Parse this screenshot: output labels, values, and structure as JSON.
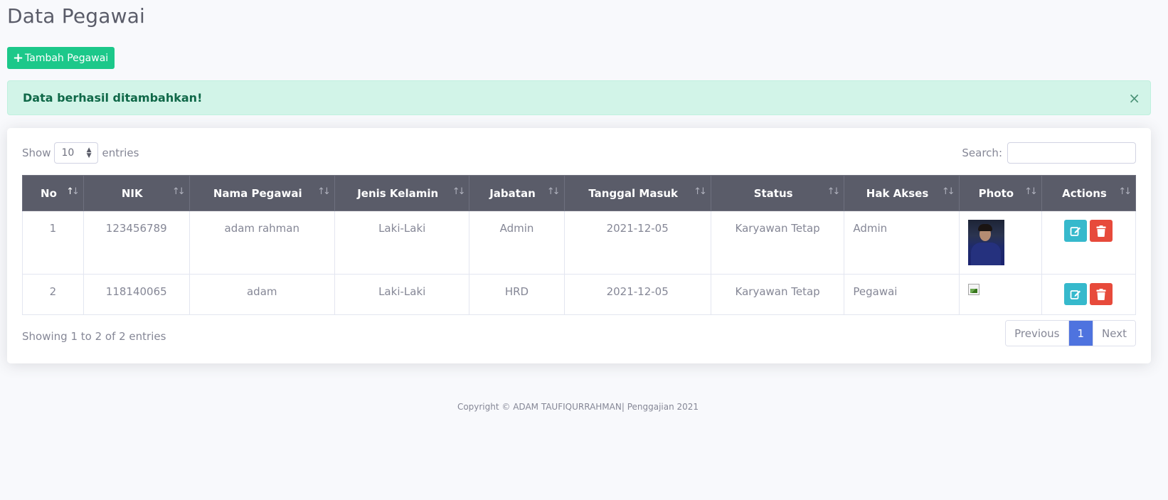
{
  "page": {
    "title": "Data Pegawai",
    "add_button_label": "Tambah Pegawai",
    "add_button_icon": "plus-icon"
  },
  "alert": {
    "message": "Data berhasil ditambahkan!",
    "close_symbol": "×"
  },
  "table_controls": {
    "show_label": "Show",
    "entries_label": "entries",
    "page_length": "10",
    "search_label": "Search:",
    "search_value": ""
  },
  "table": {
    "columns": [
      "No",
      "NIK",
      "Nama Pegawai",
      "Jenis Kelamin",
      "Jabatan",
      "Tanggal Masuk",
      "Status",
      "Hak Akses",
      "Photo",
      "Actions"
    ],
    "sorted_column": "No",
    "rows": [
      {
        "no": "1",
        "nik": "123456789",
        "nama": "adam rahman",
        "jenis_kelamin": "Laki-Laki",
        "jabatan": "Admin",
        "tanggal_masuk": "2021-12-05",
        "status": "Karyawan Tetap",
        "hak_akses": "Admin",
        "photo": "employee-photo"
      },
      {
        "no": "2",
        "nik": "118140065",
        "nama": "adam",
        "jenis_kelamin": "Laki-Laki",
        "jabatan": "HRD",
        "tanggal_masuk": "2021-12-05",
        "status": "Karyawan Tetap",
        "hak_akses": "Pegawai",
        "photo": "broken-image-icon"
      }
    ],
    "action_icons": [
      "edit-icon",
      "trash-icon"
    ]
  },
  "pagination": {
    "info": "Showing 1 to 2 of 2 entries",
    "previous_label": "Previous",
    "current_page": "1",
    "next_label": "Next"
  },
  "footer": {
    "text": "Copyright © ADAM TAUFIQURRAHMAN| Penggajian 2021"
  },
  "colors": {
    "primary": "#4e73df",
    "success": "#1cc88a",
    "info": "#36b9cc",
    "danger": "#e74a3b",
    "header_dark": "#5a5c69",
    "alert_bg": "#d2f4e8"
  }
}
